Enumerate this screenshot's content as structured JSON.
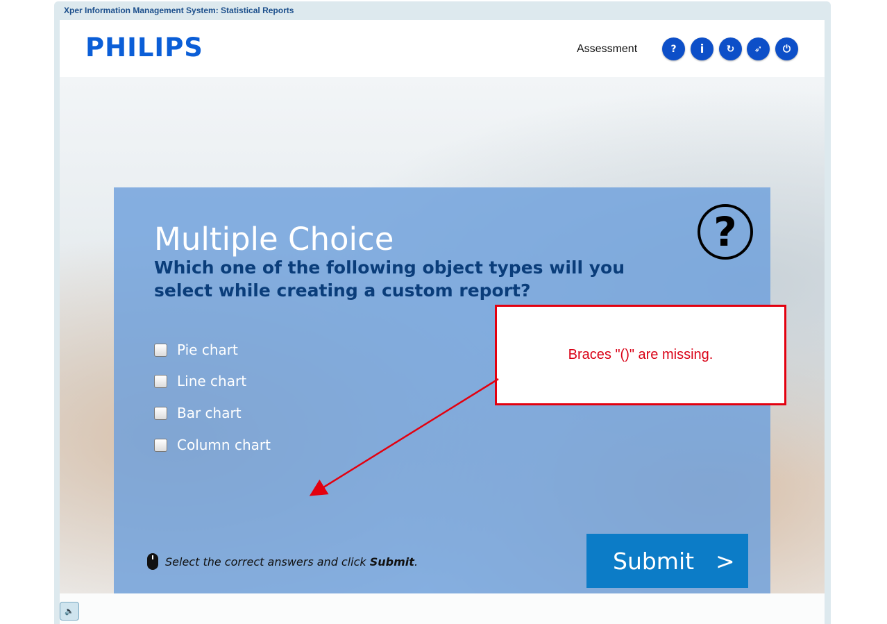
{
  "window": {
    "title": "Xper Information Management System: Statistical Reports"
  },
  "header": {
    "logo": "PHILIPS",
    "mode_label": "Assessment",
    "buttons": [
      {
        "icon": "help-icon",
        "glyph": "?"
      },
      {
        "icon": "info-icon",
        "glyph": "i"
      },
      {
        "icon": "replay-icon",
        "glyph": "↻"
      },
      {
        "icon": "compass-icon",
        "glyph": "➶"
      },
      {
        "icon": "power-icon",
        "glyph": "⏻"
      }
    ]
  },
  "question": {
    "title": "Multiple Choice",
    "text": "Which one of the following object types will you select while creating a custom report?",
    "help_glyph": "?",
    "options": [
      "Pie chart",
      "Line chart",
      "Bar chart",
      "Column chart"
    ],
    "instruction_prefix": "Select the correct answers and click ",
    "instruction_bold": "Submit",
    "instruction_suffix": ".",
    "submit_label": "Submit",
    "submit_arrow": ">"
  },
  "callout": {
    "text": "Braces \"()\" are missing.",
    "color": "#d90015"
  },
  "footer": {
    "audio_glyph": "🔈"
  }
}
